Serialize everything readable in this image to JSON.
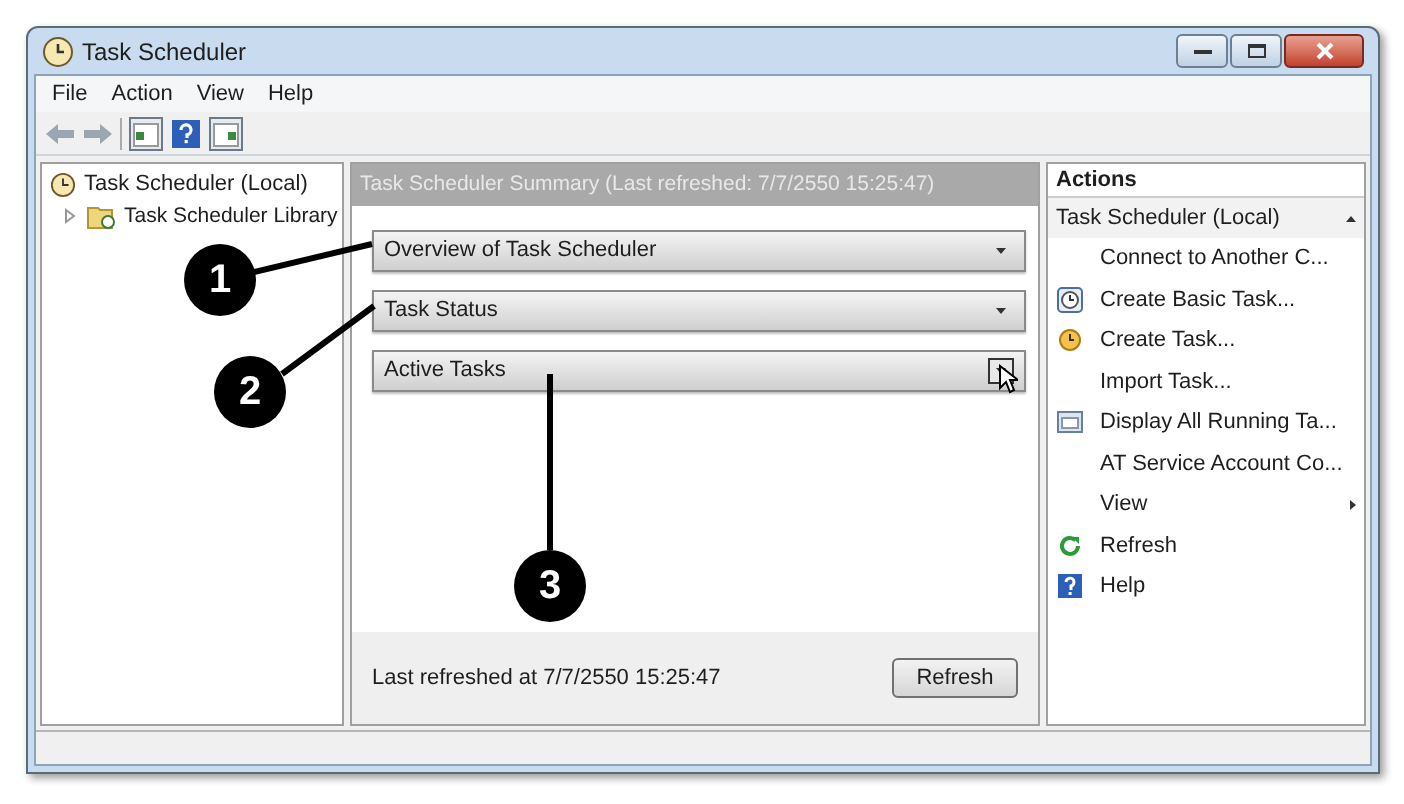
{
  "window": {
    "title": "Task Scheduler"
  },
  "menu": [
    "File",
    "Action",
    "View",
    "Help"
  ],
  "tree": [
    {
      "label": "Task Scheduler  (Local)",
      "selected": false,
      "children": [
        {
          "label": "Task Scheduler Library",
          "expanded": false
        }
      ]
    }
  ],
  "summary": {
    "title": "Task Scheduler Summary (Last refreshed: 7/7/2550 15:25:47)",
    "sections": [
      {
        "label": "Overview of Task Scheduler",
        "hovered": false
      },
      {
        "label": "Task Status",
        "hovered": false
      },
      {
        "label": "Active Tasks",
        "hovered": true
      }
    ],
    "last_refreshed": "Last refreshed at 7/7/2550 15:25:47",
    "refresh_button": "Refresh"
  },
  "actions": {
    "title": "Actions",
    "group": "Task Scheduler  (Local)",
    "items": [
      {
        "label": "Connect to Another C...",
        "kind": "plain"
      },
      {
        "label": "Create Basic Task...",
        "kind": "basic"
      },
      {
        "label": "Create Task...",
        "kind": "create"
      },
      {
        "label": "Import Task...",
        "kind": "plain"
      },
      {
        "label": "Display All Running Ta...",
        "kind": "running"
      },
      {
        "label": "AT Service Account Co...",
        "kind": "plain"
      },
      {
        "label": "View",
        "kind": "submenu"
      },
      {
        "label": "Refresh",
        "kind": "refresh"
      },
      {
        "label": "Help",
        "kind": "help"
      }
    ]
  },
  "callouts": [
    "1",
    "2",
    "3"
  ]
}
